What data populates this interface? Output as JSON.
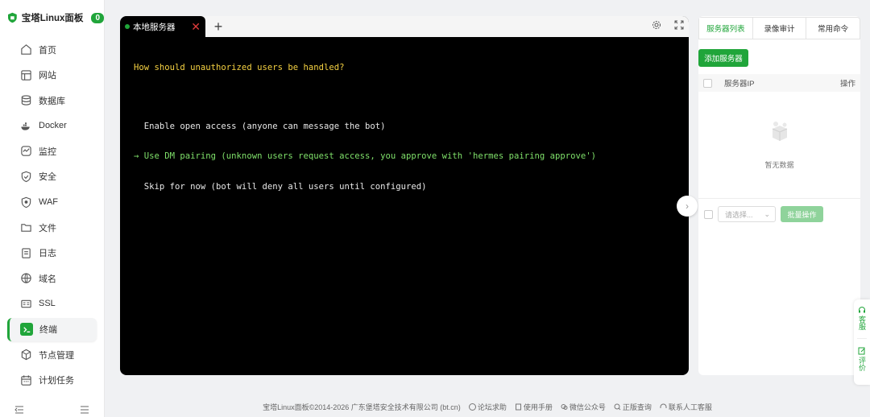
{
  "brand": {
    "name": "宝塔Linux面板",
    "badge": "0",
    "accent": "#20a53a"
  },
  "sidebar": {
    "items": [
      {
        "label": "首页",
        "icon": "home-icon"
      },
      {
        "label": "网站",
        "icon": "website-icon"
      },
      {
        "label": "数据库",
        "icon": "database-icon"
      },
      {
        "label": "Docker",
        "icon": "docker-icon"
      },
      {
        "label": "监控",
        "icon": "monitor-icon"
      },
      {
        "label": "安全",
        "icon": "shield-icon"
      },
      {
        "label": "WAF",
        "icon": "waf-icon"
      },
      {
        "label": "文件",
        "icon": "folder-icon"
      },
      {
        "label": "日志",
        "icon": "log-icon"
      },
      {
        "label": "域名",
        "icon": "globe-icon"
      },
      {
        "label": "SSL",
        "icon": "ssl-icon"
      },
      {
        "label": "终端",
        "icon": "terminal-icon",
        "active": true
      },
      {
        "label": "节点管理",
        "icon": "node-icon"
      },
      {
        "label": "计划任务",
        "icon": "calendar-icon"
      }
    ]
  },
  "terminal": {
    "tab_label": "本地服务器",
    "question": "How should unauthorized users be handled?",
    "options": [
      {
        "text": "  Enable open access (anyone can message the bot)",
        "selected": false
      },
      {
        "text": "→ Use DM pairing (unknown users request access, you approve with 'hermes pairing approve')",
        "selected": true
      },
      {
        "text": "  Skip for now (bot will deny all users until configured)",
        "selected": false
      }
    ]
  },
  "right_panel": {
    "tabs": [
      "服务器列表",
      "录像审计",
      "常用命令"
    ],
    "active_tab": 0,
    "add_button": "添加服务器",
    "col_ip": "服务器IP",
    "col_action": "操作",
    "empty_text": "暂无数据",
    "select_placeholder": "请选择...",
    "batch_button": "批量操作"
  },
  "float": {
    "service": "客服",
    "review": "评价"
  },
  "footer": {
    "copyright": "宝塔Linux面板©2014-2026 广东堡塔安全技术有限公司 (bt.cn)",
    "links": [
      "论坛求助",
      "使用手册",
      "微信公众号",
      "正版查询",
      "联系人工客服"
    ]
  }
}
